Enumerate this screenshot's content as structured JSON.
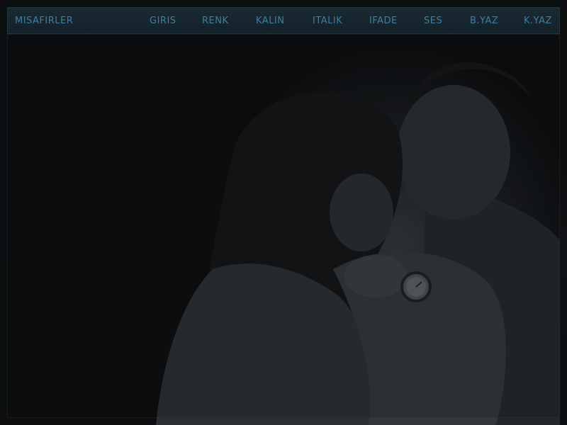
{
  "navbar": {
    "brand": "MISAFIRLER",
    "items": [
      {
        "label": "GIRIS"
      },
      {
        "label": "RENK"
      },
      {
        "label": "KALIN"
      },
      {
        "label": "ITALIK"
      },
      {
        "label": "IFADE"
      },
      {
        "label": "SES"
      },
      {
        "label": "B.YAZ"
      },
      {
        "label": "K.YAZ"
      }
    ]
  },
  "colors": {
    "nav_bg": "#16252e",
    "nav_text": "#3e7fa0",
    "page_bg": "#0b0d0f"
  }
}
